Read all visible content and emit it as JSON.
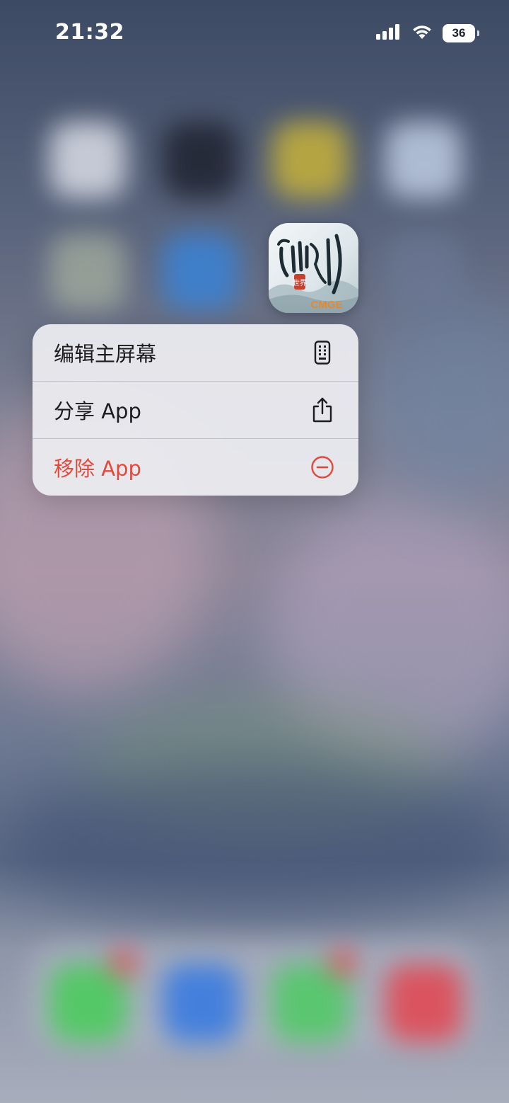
{
  "status_bar": {
    "time": "21:32",
    "battery_level": "36",
    "icons": [
      "cellular-signal-icon",
      "wifi-icon",
      "battery-icon"
    ]
  },
  "focused_app": {
    "icon_text_main": "仙剑",
    "icon_text_seal": "世界",
    "icon_text_brand": "CMGE"
  },
  "context_menu": {
    "items": [
      {
        "label": "编辑主屏幕",
        "icon": "phone-grid-icon",
        "destructive": false
      },
      {
        "label": "分享 App",
        "icon": "share-icon",
        "destructive": false
      },
      {
        "label": "移除 App",
        "icon": "minus-circle-icon",
        "destructive": true
      }
    ]
  },
  "colors": {
    "destructive": "#e2493b",
    "menu_background": "#ececf0",
    "text_primary": "#1c1c1e",
    "brand_orange": "#e8892b"
  }
}
